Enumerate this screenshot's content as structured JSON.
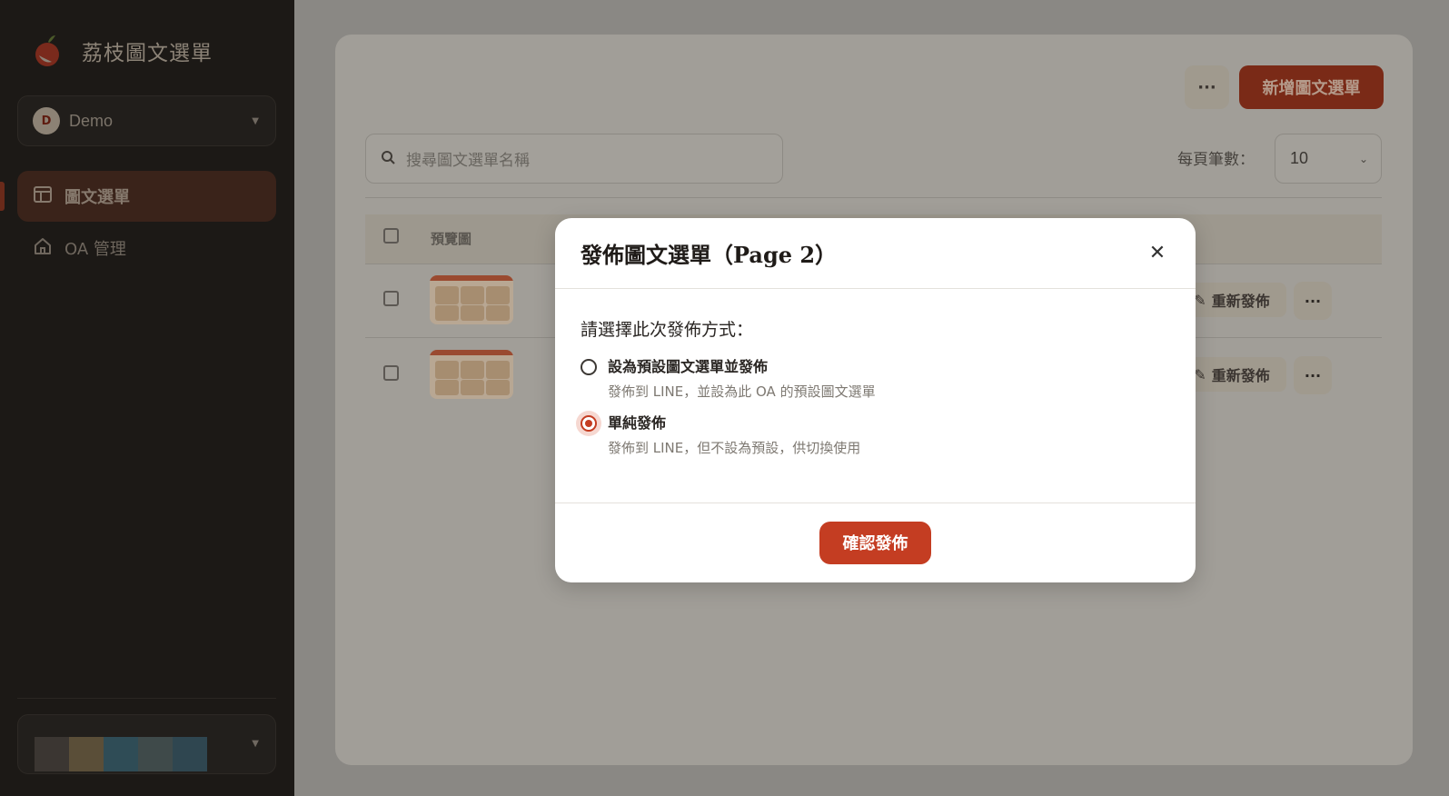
{
  "sidebar": {
    "brand_title": "荔枝圖文選單",
    "workspace": {
      "avatar_letter": "D",
      "name": "Demo"
    },
    "nav": [
      {
        "label": "圖文選單",
        "active": true
      },
      {
        "label": "OA 管理",
        "active": false
      }
    ]
  },
  "main": {
    "more_label": "···",
    "add_button": "新增圖文選單",
    "search_placeholder": "搜尋圖文選單名稱",
    "per_page_label": "每頁筆數：",
    "per_page_value": "10",
    "table": {
      "header_preview": "預覽圖",
      "rows": [
        {
          "republish_label": "重新發佈"
        },
        {
          "republish_label": "重新發佈"
        }
      ]
    }
  },
  "modal": {
    "title": "發佈圖文選單（Page 2）",
    "prompt": "請選擇此次發佈方式：",
    "options": [
      {
        "title": "設為預設圖文選單並發佈",
        "desc": "發佈到 LINE，並設為此 OA 的預設圖文選單",
        "checked": false
      },
      {
        "title": "單純發佈",
        "desc": "發佈到 LINE，但不設為預設，供切換使用",
        "checked": true
      }
    ],
    "confirm_button": "確認發佈"
  },
  "colors": {
    "accent": "#c43d22",
    "sidebar_bg": "#1c1916",
    "overlay": "#8a8884"
  }
}
